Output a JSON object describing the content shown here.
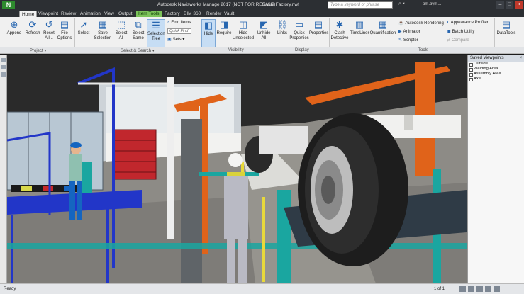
{
  "window": {
    "app_badge": "N",
    "title": "Autodesk Navisworks Manage 2017 (NOT FOR RESALE)",
    "document": "Entire Factory.nwf",
    "search_placeholder": "Type a keyword or phrase",
    "user": "pm.bym..."
  },
  "tabs": [
    "Home",
    "Viewpoint",
    "Review",
    "Animation",
    "View",
    "Output",
    "Item Tools",
    "Factory",
    "BIM 360",
    "Render",
    "Vault"
  ],
  "ribbon": {
    "append": "Append",
    "refresh": "Refresh",
    "reset_all": "Reset All...",
    "file_options": "File Options",
    "select": "Select",
    "save_selection": "Save Selection",
    "select_all": "Select All",
    "select_same": "Select Same",
    "selection_tree": "Selection Tree",
    "find_items": "Find Items",
    "quick_find": "Quick Find",
    "sets": "Sets",
    "hide": "Hide",
    "require": "Require",
    "hide_unselected": "Hide Unselected",
    "unhide_all": "Unhide All",
    "links": "Links",
    "quick_properties": "Quick Properties",
    "properties": "Properties",
    "clash_detective": "Clash Detective",
    "timeliner": "TimeLiner",
    "quantification": "Quantification",
    "autodesk_rendering": "Autodesk Rendering",
    "animator": "Animator",
    "scripter": "Scripter",
    "appearance_profiler": "Appearance Profiler",
    "batch_utility": "Batch Utility",
    "compare": "Compare",
    "datatools": "DataTools"
  },
  "panels": {
    "project": "Project ▾",
    "select_search": "Select & Search ▾",
    "visibility": "Visibility",
    "display": "Display",
    "tools": "Tools"
  },
  "saved_viewpoints": {
    "title": "Saved Viewpoints",
    "items": [
      "Outside",
      "Welding Area",
      "Assembly Area",
      "Axel"
    ]
  },
  "status": {
    "ready": "Ready",
    "pages": "1 of 1"
  },
  "colors": {
    "title_bg": "#2c2f33",
    "contextual_tab": "#7cc35a",
    "crane_orange": "#e0631a",
    "frame_blue": "#2236c8",
    "teal_frame": "#1aa6a0"
  }
}
